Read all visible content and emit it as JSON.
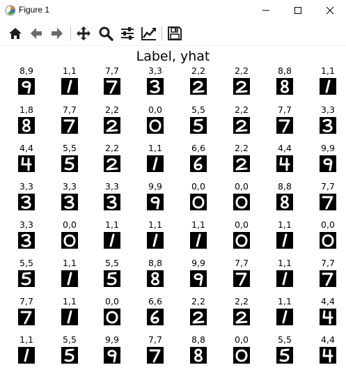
{
  "window": {
    "title": "Figure 1"
  },
  "toolbar": {
    "buttons": [
      {
        "name": "home-button",
        "icon": "home-icon"
      },
      {
        "name": "back-button",
        "icon": "arrow-left-icon"
      },
      {
        "name": "forward-button",
        "icon": "arrow-right-icon"
      },
      {
        "name": "pan-button",
        "icon": "move-icon"
      },
      {
        "name": "zoom-button",
        "icon": "magnifier-icon"
      },
      {
        "name": "configure-subplots-button",
        "icon": "sliders-icon"
      },
      {
        "name": "edit-axes-button",
        "icon": "line-chart-icon"
      },
      {
        "name": "save-button",
        "icon": "floppy-disk-icon"
      }
    ]
  },
  "figure": {
    "title": "Label, yhat",
    "rows": [
      [
        "8,9",
        "1,1",
        "7,7",
        "3,3",
        "2,2",
        "2,2",
        "8,8",
        "1,1"
      ],
      [
        "1,8",
        "7,7",
        "2,2",
        "0,0",
        "5,5",
        "2,2",
        "7,7",
        "3,3"
      ],
      [
        "4,4",
        "5,5",
        "2,2",
        "1,1",
        "6,6",
        "2,2",
        "4,4",
        "9,9"
      ],
      [
        "3,3",
        "3,3",
        "3,3",
        "9,9",
        "0,0",
        "0,0",
        "8,8",
        "7,7"
      ],
      [
        "3,3",
        "0,0",
        "1,1",
        "1,1",
        "1,1",
        "0,0",
        "1,1",
        "0,0"
      ],
      [
        "5,5",
        "1,1",
        "5,5",
        "8,8",
        "9,9",
        "7,7",
        "1,1",
        "7,7"
      ],
      [
        "7,7",
        "1,1",
        "0,0",
        "6,6",
        "2,2",
        "2,2",
        "1,1",
        "4,4"
      ],
      [
        "1,1",
        "5,5",
        "9,9",
        "7,7",
        "8,8",
        "0,0",
        "5,5",
        "4,4"
      ]
    ]
  }
}
